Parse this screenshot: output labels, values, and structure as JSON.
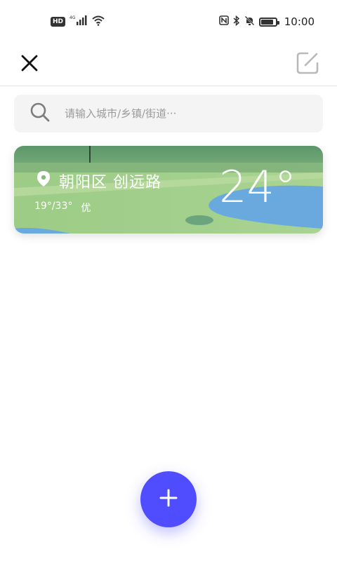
{
  "status_bar": {
    "network_badge": "HD",
    "network_type": "4G",
    "time": "10:00",
    "icons": [
      "hd-icon",
      "signal-icon",
      "wifi-icon",
      "nfc-icon",
      "bluetooth-icon",
      "mute-bell-icon",
      "battery-icon"
    ]
  },
  "app_bar": {
    "close_icon": "close-icon",
    "edit_icon": "edit-icon"
  },
  "search": {
    "placeholder": "请输入城市/乡镇/街道···",
    "value": ""
  },
  "city_card": {
    "location": "朝阳区 创远路",
    "temp_range": "19°/33°",
    "air_quality": "优",
    "current_temp": "24°",
    "location_icon": "location-pin-icon"
  },
  "fab": {
    "icon": "plus-icon",
    "color": "#4f4dff"
  }
}
